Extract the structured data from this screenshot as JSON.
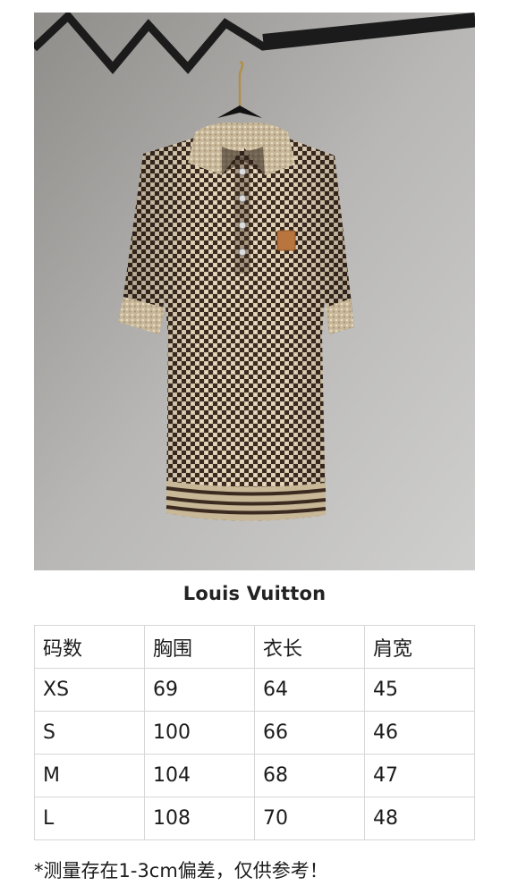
{
  "brand": "Louis Vuitton",
  "table": {
    "headers": [
      "码数",
      "胸围",
      "衣长",
      "肩宽"
    ],
    "rows": [
      [
        "XS",
        "69",
        "64",
        "45"
      ],
      [
        "S",
        "100",
        "66",
        "46"
      ],
      [
        "M",
        "104",
        "68",
        "47"
      ],
      [
        "L",
        "108",
        "70",
        "48"
      ]
    ]
  },
  "note": "*测量存在1-3cm偏差，仅供参考！"
}
